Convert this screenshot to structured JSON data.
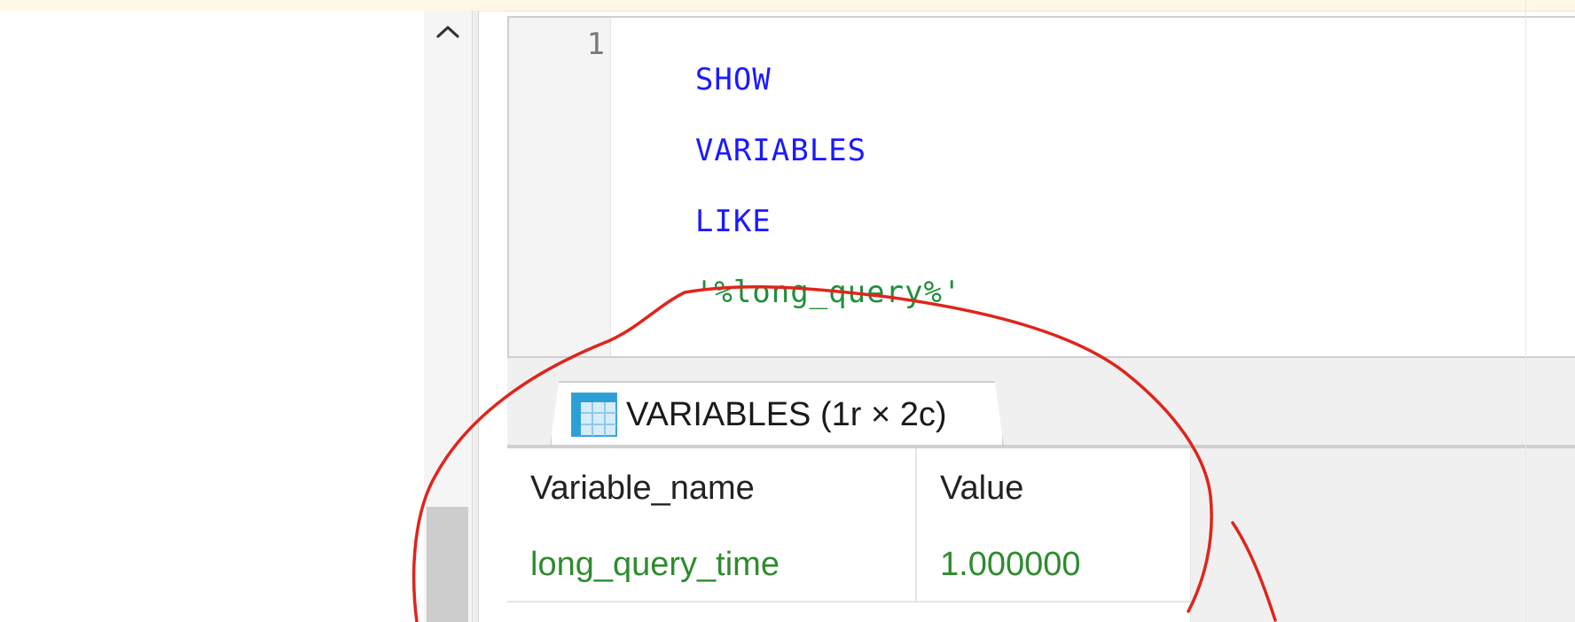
{
  "editor": {
    "line_number": "1",
    "code": {
      "kw1": "SHOW",
      "kw2": "VARIABLES",
      "kw3": "LIKE",
      "string": "'%long_query%'"
    }
  },
  "result": {
    "tab_label": "VARIABLES (1r × 2c)",
    "columns": [
      "Variable_name",
      "Value"
    ],
    "rows": [
      [
        "long_query_time",
        "1.000000"
      ]
    ]
  },
  "colors": {
    "keyword": "#1a1aff",
    "string": "#1f8f3a",
    "annotation": "#e0241b"
  },
  "icons": {
    "scroll_up": "chevron-up-icon",
    "tab_icon": "table-grid-icon"
  }
}
